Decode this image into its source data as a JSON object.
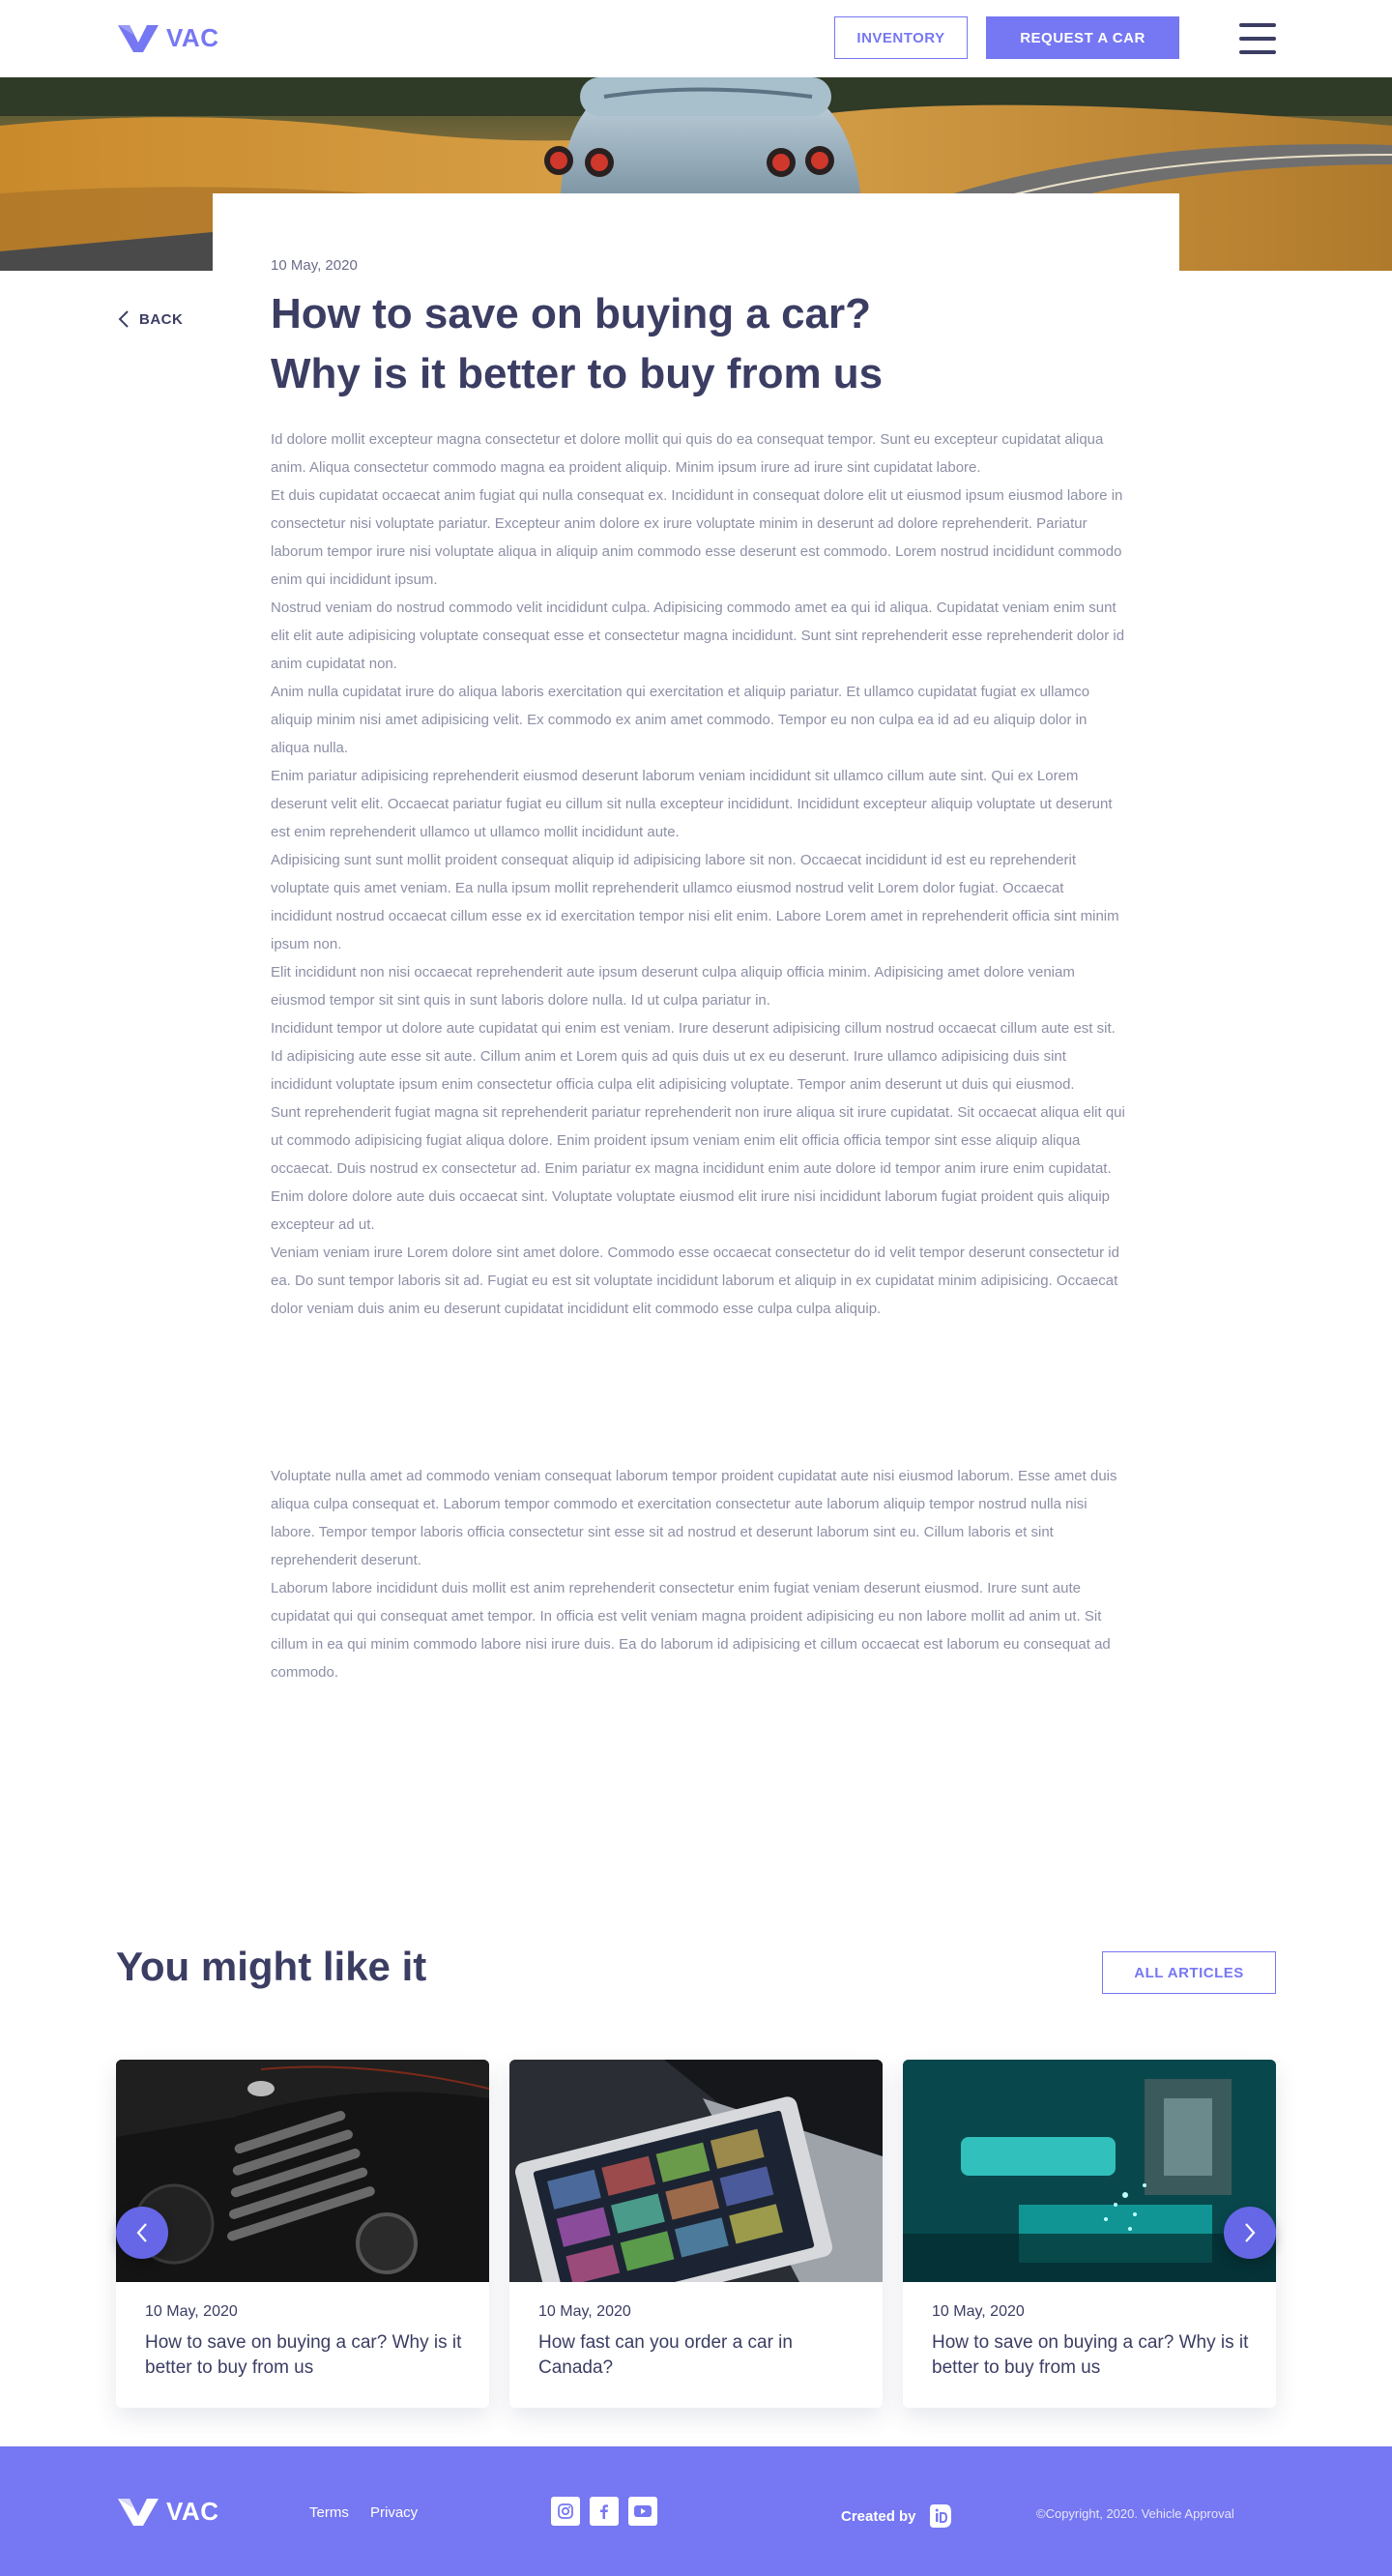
{
  "header": {
    "logo_text": "VAC",
    "inventory_label": "INVENTORY",
    "request_label": "REQUEST A CAR"
  },
  "article": {
    "back_label": "BACK",
    "date": "10 May, 2020",
    "title_line1": "How to save on buying a car?",
    "title_line2": "Why is it better to buy from us",
    "paragraphs": [
      "Id dolore mollit excepteur magna consectetur et dolore mollit qui quis do ea consequat tempor. Sunt eu excepteur cupidatat aliqua anim. Aliqua consectetur commodo magna ea proident aliquip. Minim ipsum irure ad irure sint cupidatat labore.",
      "Et duis cupidatat occaecat anim fugiat qui nulla consequat ex. Incididunt in consequat dolore elit ut eiusmod ipsum eiusmod labore in consectetur nisi voluptate pariatur. Excepteur anim dolore ex irure voluptate minim in deserunt ad dolore reprehenderit. Pariatur laborum tempor irure nisi voluptate aliqua in aliquip anim commodo esse deserunt est commodo. Lorem nostrud incididunt commodo enim qui incididunt ipsum.",
      "Nostrud veniam do nostrud commodo velit incididunt culpa. Adipisicing commodo amet ea qui id aliqua. Cupidatat veniam enim sunt elit elit aute adipisicing voluptate consequat esse et consectetur magna incididunt. Sunt sint reprehenderit esse reprehenderit dolor id anim cupidatat non.",
      "Anim nulla cupidatat irure do aliqua laboris exercitation qui exercitation et aliquip pariatur. Et ullamco cupidatat fugiat ex ullamco aliquip minim nisi amet adipisicing velit. Ex commodo ex anim amet commodo. Tempor eu non culpa ea id ad eu aliquip dolor in aliqua nulla.",
      "Enim pariatur adipisicing reprehenderit eiusmod deserunt laborum veniam incididunt sit ullamco cillum aute sint. Qui ex Lorem deserunt velit elit. Occaecat pariatur fugiat eu cillum sit nulla excepteur incididunt. Incididunt excepteur aliquip voluptate ut deserunt est enim reprehenderit ullamco ut ullamco mollit incididunt aute.",
      "Adipisicing sunt sunt mollit proident consequat aliquip id adipisicing labore sit non. Occaecat incididunt id est eu reprehenderit voluptate quis amet veniam. Ea nulla ipsum mollit reprehenderit ullamco eiusmod nostrud velit Lorem dolor fugiat. Occaecat incididunt nostrud occaecat cillum esse ex id exercitation tempor nisi elit enim. Labore Lorem amet in reprehenderit officia sint minim ipsum non.",
      "Elit incididunt non nisi occaecat reprehenderit aute ipsum deserunt culpa aliquip officia minim. Adipisicing amet dolore veniam eiusmod tempor sit sint quis in sunt laboris dolore nulla. Id ut culpa pariatur in.",
      "Incididunt tempor ut dolore aute cupidatat qui enim est veniam. Irure deserunt adipisicing cillum nostrud occaecat cillum aute est sit. Id adipisicing aute esse sit aute. Cillum anim et Lorem quis ad quis duis ut ex eu deserunt. Irure ullamco adipisicing duis sint incididunt voluptate ipsum enim consectetur officia culpa elit adipisicing voluptate. Tempor anim deserunt ut duis qui eiusmod.",
      "Sunt reprehenderit fugiat magna sit reprehenderit pariatur reprehenderit non irure aliqua sit irure cupidatat. Sit occaecat aliqua elit qui ut commodo adipisicing fugiat aliqua dolore. Enim proident ipsum veniam enim elit officia officia tempor sint esse aliquip aliqua occaecat. Duis nostrud ex consectetur ad. Enim pariatur ex magna incididunt enim aute dolore id tempor anim irure enim cupidatat. Enim dolore dolore aute duis occaecat sint. Voluptate voluptate eiusmod elit irure nisi incididunt laborum fugiat proident quis aliquip excepteur ad ut.",
      "Veniam veniam irure Lorem dolore sint amet dolore. Commodo esse occaecat consectetur do id velit tempor deserunt consectetur id ea. Do sunt tempor laboris sit ad. Fugiat eu est sit voluptate incididunt laborum et aliquip in ex cupidatat minim adipisicing. Occaecat dolor veniam duis anim eu deserunt cupidatat incididunt elit commodo esse culpa culpa aliquip."
    ],
    "paragraphs2": [
      "Voluptate nulla amet ad commodo veniam consequat laborum tempor proident cupidatat aute nisi eiusmod laborum. Esse amet duis aliqua culpa consequat et. Laborum tempor commodo et exercitation consectetur aute laborum aliquip tempor nostrud nulla nisi labore. Tempor tempor laboris officia consectetur sint esse sit ad nostrud et deserunt laborum sint eu. Cillum laboris et sint reprehenderit deserunt.",
      "Laborum labore incididunt duis mollit est anim reprehenderit consectetur enim fugiat veniam deserunt eiusmod. Irure sunt aute cupidatat qui qui consequat amet tempor. In officia est velit veniam magna proident adipisicing eu non labore mollit ad anim ut. Sit cillum in ea qui minim commodo labore nisi irure duis. Ea do laborum id adipisicing et cillum occaecat est laborum eu consequat ad commodo."
    ]
  },
  "related": {
    "heading": "You might like it",
    "all_articles_label": "ALL ARTICLES",
    "cards": [
      {
        "date": "10 May, 2020",
        "title": "How to save on buying a car? Why is it better to buy from us",
        "image": "motorcycle-engine"
      },
      {
        "date": "10 May, 2020",
        "title": "How fast can you order a car in Canada?",
        "image": "tablet-laptop"
      },
      {
        "date": "10 May, 2020",
        "title": "How to save on buying a car? Why is it better to buy from us",
        "image": "teal-machine"
      }
    ]
  },
  "footer": {
    "logo_text": "VAC",
    "terms_label": "Terms",
    "privacy_label": "Privacy",
    "social_icons": [
      "instagram-icon",
      "facebook-icon",
      "youtube-icon"
    ],
    "created_by_label": "Created by",
    "copyright": "©Copyright, 2020. Vehicle Approval"
  },
  "colors": {
    "accent": "#7677f2",
    "heading": "#3b3d63",
    "body_text": "#8d8fa6"
  }
}
